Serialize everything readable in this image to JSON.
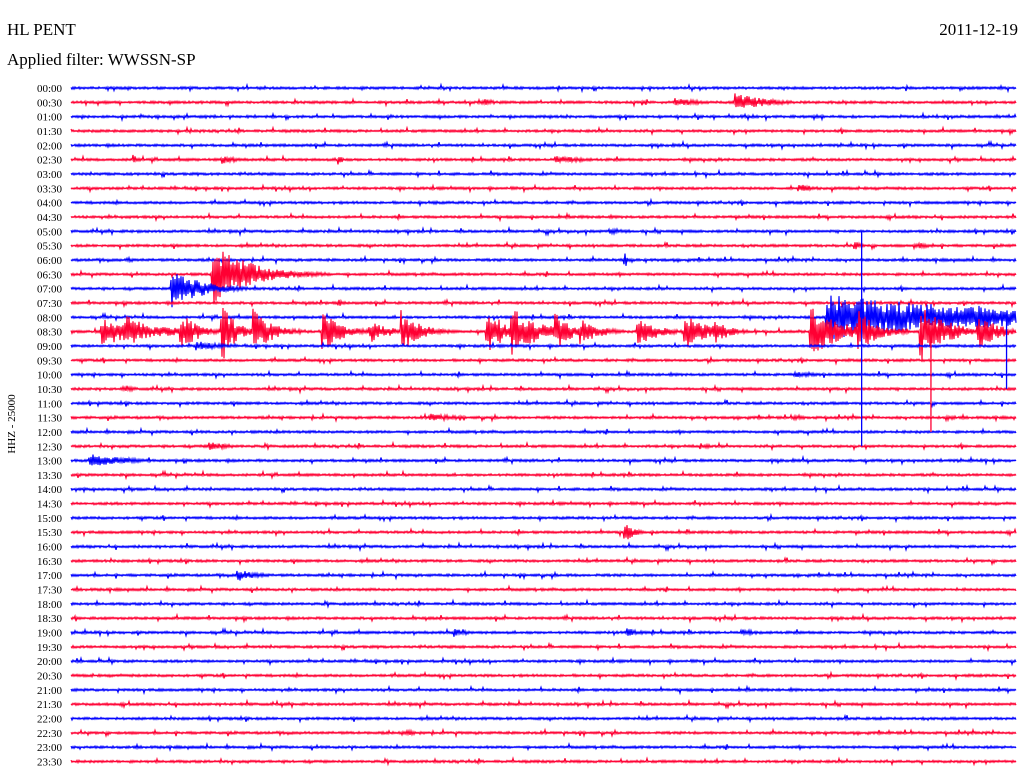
{
  "header": {
    "station": "HL PENT",
    "date": "2011-12-19",
    "filter": "Applied filter: WWSSN-SP"
  },
  "chart_data": {
    "type": "line",
    "title": "HL PENT",
    "subtitle": "Applied filter: WWSSN-SP",
    "ylabel": "HHZ - 25000",
    "row_minutes": 30,
    "colors": {
      "even": "#0000ff",
      "odd": "#ff0033"
    },
    "rows": [
      "00:00",
      "00:30",
      "01:00",
      "01:30",
      "02:00",
      "02:30",
      "03:00",
      "03:30",
      "04:00",
      "04:30",
      "05:00",
      "05:30",
      "06:00",
      "06:30",
      "07:00",
      "07:30",
      "08:00",
      "08:30",
      "09:00",
      "09:30",
      "10:00",
      "10:30",
      "11:00",
      "11:30",
      "12:00",
      "12:30",
      "13:00",
      "13:30",
      "14:00",
      "14:30",
      "15:00",
      "15:30",
      "16:00",
      "16:30",
      "17:00",
      "17:30",
      "18:00",
      "18:30",
      "19:00",
      "19:30",
      "20:00",
      "20:30",
      "21:00",
      "21:30",
      "22:00",
      "22:30",
      "23:00",
      "23:30"
    ],
    "events": [
      [
        1,
        13.1,
        0.25,
        0.4
      ],
      [
        1,
        19.2,
        0.3,
        0.8
      ],
      [
        1,
        21.1,
        0.7,
        0.9
      ],
      [
        5,
        2.0,
        0.45,
        0.1
      ],
      [
        5,
        4.8,
        0.3,
        0.5
      ],
      [
        5,
        8.5,
        0.6,
        0.1
      ],
      [
        5,
        15.4,
        0.3,
        0.9
      ],
      [
        7,
        23.1,
        0.3,
        0.6
      ],
      [
        8,
        11.4,
        0.12,
        1.0
      ],
      [
        10,
        17.1,
        0.25,
        0.6
      ],
      [
        11,
        24.9,
        0.35,
        0.2
      ],
      [
        11,
        26.8,
        0.2,
        1.0
      ],
      [
        12,
        17.6,
        0.55,
        0.1
      ],
      [
        12,
        1.8,
        0.2,
        0.3
      ],
      [
        13,
        4.5,
        2.2,
        1.2
      ],
      [
        14,
        3.2,
        1.5,
        0.9
      ],
      [
        15,
        8.5,
        0.3,
        0.1
      ],
      [
        17,
        1.0,
        0.9,
        2.0
      ],
      [
        17,
        1.8,
        1.3,
        0.6
      ],
      [
        17,
        3.5,
        1.5,
        0.5
      ],
      [
        17,
        4.8,
        2.2,
        0.4
      ],
      [
        17,
        5.8,
        1.6,
        0.6
      ],
      [
        17,
        8.0,
        1.4,
        0.6
      ],
      [
        17,
        9.5,
        0.8,
        0.6
      ],
      [
        17,
        10.5,
        1.5,
        0.6
      ],
      [
        17,
        13.2,
        1.6,
        0.6
      ],
      [
        17,
        14.0,
        1.8,
        0.8
      ],
      [
        17,
        15.4,
        1.3,
        0.5
      ],
      [
        17,
        16.2,
        0.9,
        0.6
      ],
      [
        17,
        18.0,
        1.1,
        0.6
      ],
      [
        17,
        19.5,
        1.4,
        0.6
      ],
      [
        17,
        20.4,
        0.9,
        0.5
      ],
      [
        17,
        23.5,
        1.8,
        0.9
      ],
      [
        17,
        25.0,
        1.6,
        0.6
      ],
      [
        17,
        27.0,
        2.0,
        0.8
      ],
      [
        17,
        28.8,
        1.3,
        0.6
      ],
      [
        16,
        24.0,
        1.6,
        6.0
      ],
      [
        16,
        26.2,
        1.2,
        1.0
      ],
      [
        16,
        28.8,
        1.1,
        1.0
      ],
      [
        18,
        4.0,
        0.35,
        0.8
      ],
      [
        20,
        23.0,
        0.2,
        0.8
      ],
      [
        21,
        1.7,
        0.2,
        0.5
      ],
      [
        23,
        11.4,
        0.3,
        0.9
      ],
      [
        23,
        23.0,
        0.2,
        0.4
      ],
      [
        23,
        27.8,
        0.2,
        0.4
      ],
      [
        25,
        4.4,
        0.35,
        0.6
      ],
      [
        25,
        20.0,
        0.2,
        0.4
      ],
      [
        26,
        0.6,
        0.5,
        1.1
      ],
      [
        31,
        17.6,
        0.65,
        0.3
      ],
      [
        34,
        5.3,
        0.4,
        0.7
      ],
      [
        38,
        12.2,
        0.3,
        0.4
      ],
      [
        38,
        17.7,
        0.3,
        0.4
      ],
      [
        38,
        21.3,
        0.25,
        0.5
      ],
      [
        45,
        10.6,
        0.2,
        0.6
      ]
    ],
    "spikes": [
      [
        25.1,
        10,
        25,
        "blue"
      ],
      [
        27.3,
        17,
        24,
        "red"
      ],
      [
        29.7,
        16,
        21,
        "blue"
      ]
    ]
  }
}
